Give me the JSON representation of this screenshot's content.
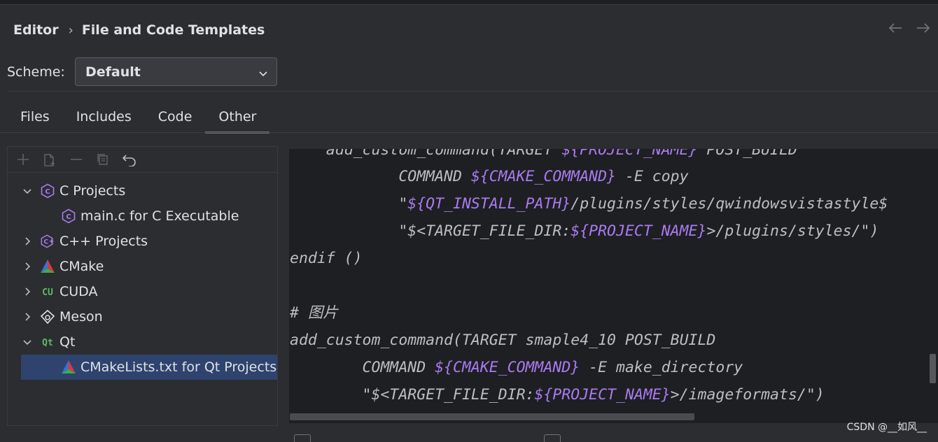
{
  "breadcrumb": {
    "parent": "Editor",
    "separator": "›",
    "current": "File and Code Templates"
  },
  "nav": {
    "back_icon": "arrow-left-icon",
    "forward_icon": "arrow-right-icon"
  },
  "scheme": {
    "label": "Scheme:",
    "value": "Default"
  },
  "tabs": [
    {
      "label": "Files",
      "active": false
    },
    {
      "label": "Includes",
      "active": false
    },
    {
      "label": "Code",
      "active": false
    },
    {
      "label": "Other",
      "active": true
    }
  ],
  "toolbar": [
    "add-icon",
    "copy-template-icon",
    "remove-icon",
    "duplicate-icon",
    "reset-icon"
  ],
  "tree": [
    {
      "label": "C Projects",
      "icon": "c-icon",
      "expanded": true,
      "level": 0
    },
    {
      "label": "main.c for C Executable",
      "icon": "c-icon",
      "level": 1
    },
    {
      "label": "C++ Projects",
      "icon": "cpp-icon",
      "expanded": false,
      "level": 0
    },
    {
      "label": "CMake",
      "icon": "cmake-icon",
      "expanded": false,
      "level": 0
    },
    {
      "label": "CUDA",
      "icon": "cuda-icon",
      "expanded": false,
      "level": 0
    },
    {
      "label": "Meson",
      "icon": "meson-icon",
      "expanded": false,
      "level": 0
    },
    {
      "label": "Qt",
      "icon": "qt-icon",
      "expanded": true,
      "level": 0
    },
    {
      "label": "CMakeLists.txt for Qt Projects",
      "icon": "cmake-icon",
      "level": 1,
      "selected": true
    }
  ],
  "code": {
    "l0a": "    add_custom_command(TARGET ",
    "l0b": "${PROJECT_NAME}",
    "l0c": " POST_BUILD",
    "l1a": "            COMMAND ",
    "l1b": "${CMAKE_COMMAND}",
    "l1c": " -E copy",
    "l2a": "            \"",
    "l2b": "${QT_INSTALL_PATH}",
    "l2c": "/plugins/styles/qwindowsvistastyle$",
    "l3a": "            \"$<TARGET_FILE_DIR:",
    "l3b": "${PROJECT_NAME}",
    "l3c": ">/plugins/styles/\")",
    "l4": "endif ()",
    "l5": "",
    "l6": "# 图片",
    "l7": "add_custom_command(TARGET smaple4_10 POST_BUILD",
    "l8a": "        COMMAND ",
    "l8b": "${CMAKE_COMMAND}",
    "l8c": " -E make_directory",
    "l9a": "        \"$<TARGET_FILE_DIR:",
    "l9b": "${PROJECT_NAME}",
    "l9c": ">/imageformats/\")"
  },
  "watermark": "CSDN @__如风__",
  "colors": {
    "background": "#2b2d30",
    "editor_bg": "#1e1f22",
    "variable": "#a97bf0",
    "selection": "#2e436e"
  }
}
